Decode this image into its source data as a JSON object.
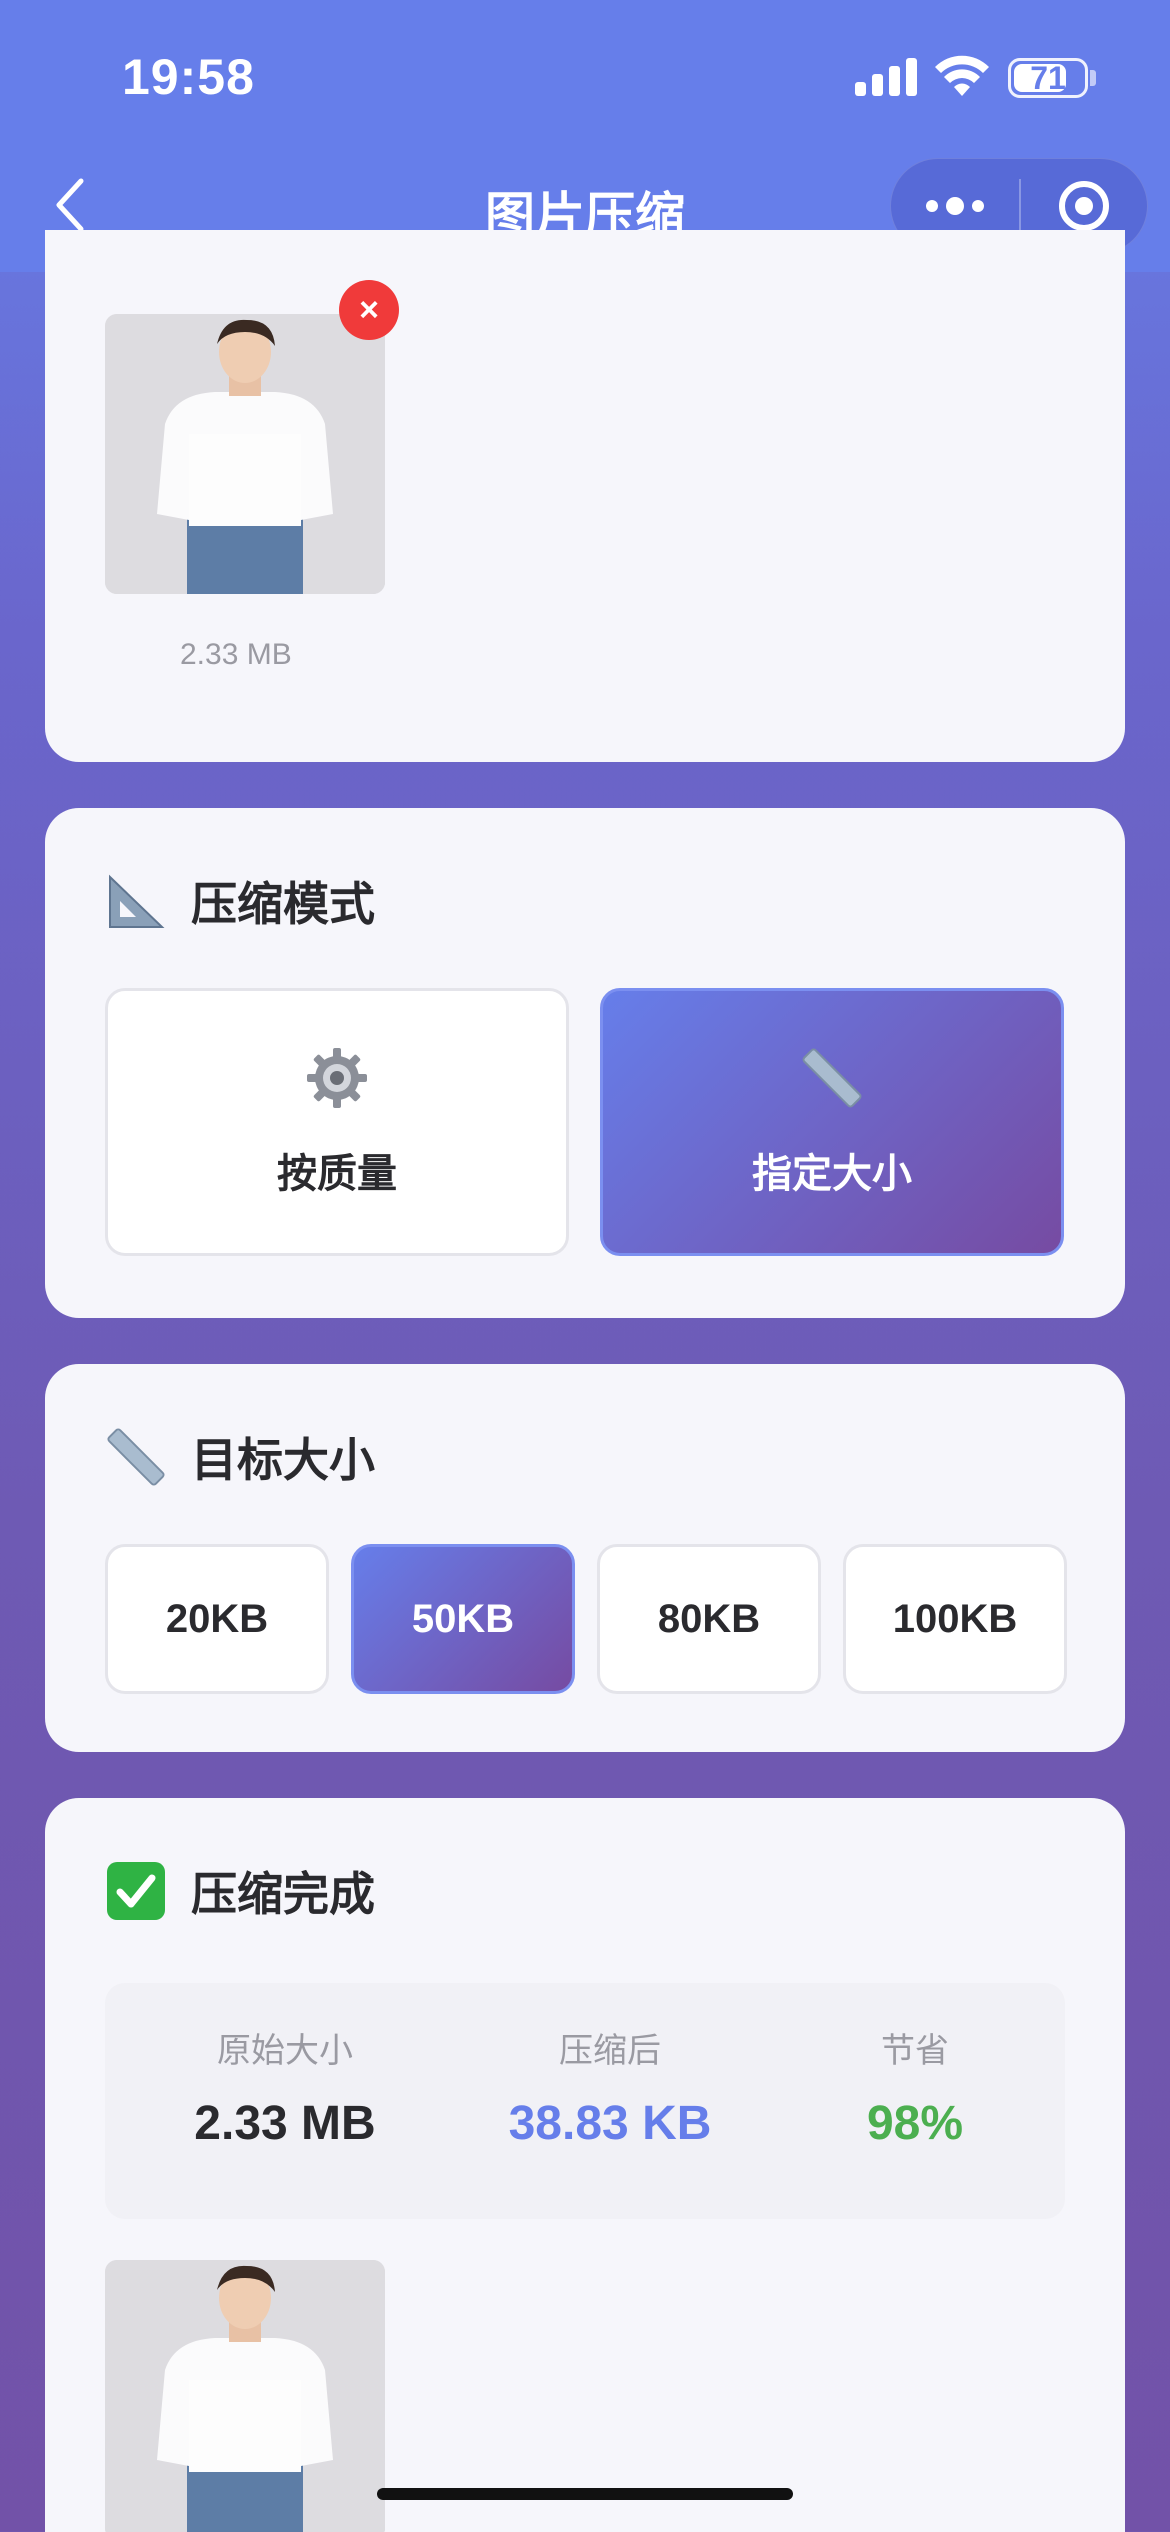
{
  "status_bar": {
    "time": "19:58",
    "battery": "71"
  },
  "nav": {
    "title": "图片压缩"
  },
  "upload": {
    "file_size": "2.33 MB",
    "delete_symbol": "×"
  },
  "mode_section": {
    "title": "压缩模式",
    "options": [
      {
        "label": "按质量",
        "icon": "gear-icon",
        "selected": false
      },
      {
        "label": "指定大小",
        "icon": "ruler-icon",
        "selected": true
      }
    ]
  },
  "size_section": {
    "title": "目标大小",
    "options": [
      {
        "label": "20KB",
        "selected": false
      },
      {
        "label": "50KB",
        "selected": true
      },
      {
        "label": "80KB",
        "selected": false
      },
      {
        "label": "100KB",
        "selected": false
      }
    ]
  },
  "result_section": {
    "title": "压缩完成",
    "stats": [
      {
        "label": "原始大小",
        "value": "2.33 MB",
        "color": "#2a2a2e"
      },
      {
        "label": "压缩后",
        "value": "38.83 KB",
        "color": "#667eea"
      },
      {
        "label": "节省",
        "value": "98%",
        "color": "#4caf50"
      }
    ]
  },
  "colors": {
    "accent_start": "#667eea",
    "accent_end": "#764ba2",
    "delete_red": "#f03a3a",
    "check_green": "#2fb344"
  }
}
